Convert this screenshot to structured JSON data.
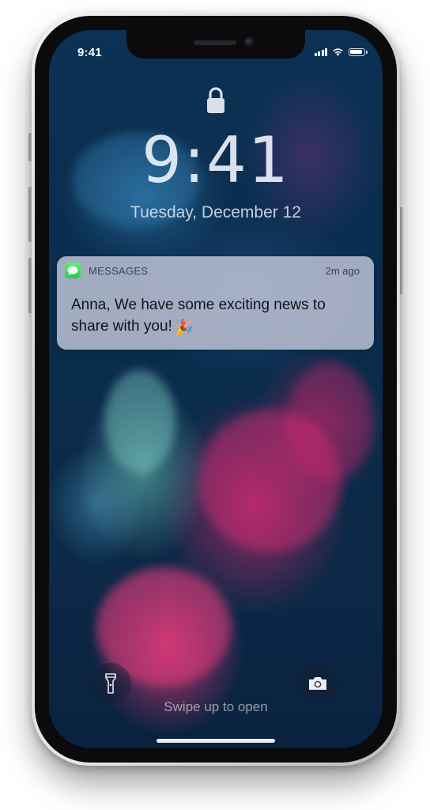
{
  "status_bar": {
    "time": "9:41",
    "signal_icon": "signal-bars-icon",
    "wifi_icon": "wifi-icon",
    "battery_icon": "battery-icon",
    "battery_level": 0.9
  },
  "lock_screen": {
    "lock_icon": "padlock-icon",
    "time": "9:41",
    "date": "Tuesday, December 12",
    "swipe_hint": "Swipe up to open"
  },
  "notification": {
    "app_icon": "messages-app-icon",
    "app_name": "MESSAGES",
    "time_ago": "2m ago",
    "body": "Anna, We have some exciting news to share with you!",
    "emoji": "🎉"
  },
  "quick_actions": {
    "flashlight_icon": "flashlight-icon",
    "camera_icon": "camera-icon"
  },
  "colors": {
    "wallpaper_base": "#0b3154",
    "smoke_pink": "#e0377a",
    "smoke_teal": "#6ec8be",
    "messages_green": "#34c759"
  }
}
